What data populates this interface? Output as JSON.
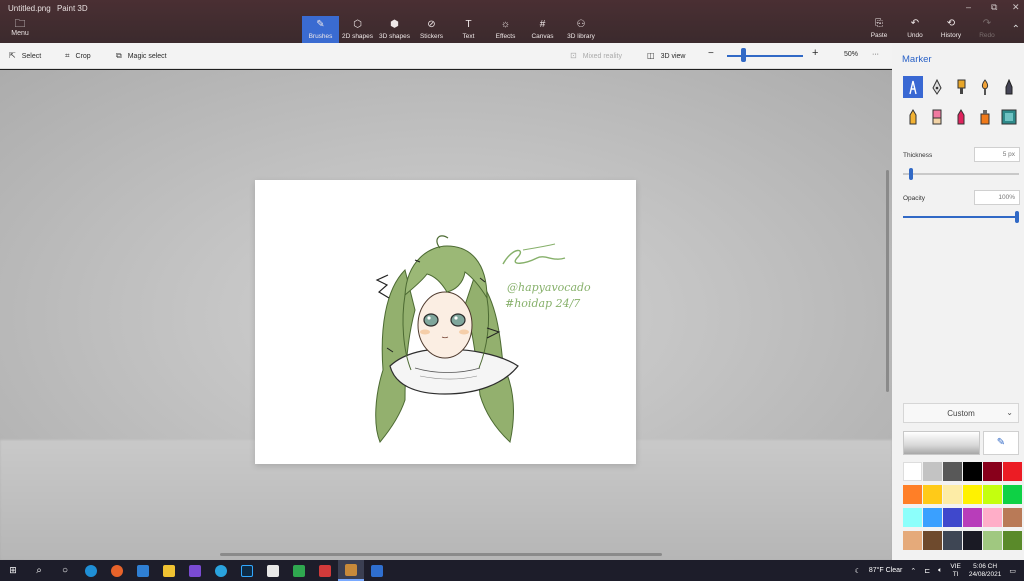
{
  "window": {
    "title": "Untitled.png",
    "app": "Paint 3D"
  },
  "ribbon": {
    "menu": "Menu",
    "tabs": [
      {
        "label": "Brushes",
        "icon": "brush-icon",
        "active": true
      },
      {
        "label": "2D shapes",
        "icon": "2d-shapes-icon"
      },
      {
        "label": "3D shapes",
        "icon": "3d-shapes-icon"
      },
      {
        "label": "Stickers",
        "icon": "stickers-icon"
      },
      {
        "label": "Text",
        "icon": "text-icon"
      },
      {
        "label": "Effects",
        "icon": "effects-icon"
      },
      {
        "label": "Canvas",
        "icon": "canvas-icon"
      },
      {
        "label": "3D library",
        "icon": "3d-library-icon"
      }
    ],
    "paste": "Paste",
    "undo": "Undo",
    "history": "History",
    "redo": "Redo"
  },
  "toolstrip": {
    "select": "Select",
    "crop": "Crop",
    "magic_select": "Magic select",
    "mixed_reality": "Mixed reality",
    "view_3d": "3D view",
    "zoom": "50%",
    "zoom_level": 0.2,
    "more": "···"
  },
  "panel": {
    "title": "Marker",
    "thickness_label": "Thickness",
    "thickness_value": "5 px",
    "thickness_level": 0.05,
    "opacity_label": "Opacity",
    "opacity_value": "100%",
    "opacity_level": 1.0,
    "color_mode": "Custom",
    "current_color": "#ffffff",
    "swatches": [
      "#ffffff",
      "#c3c3c3",
      "#585858",
      "#000000",
      "#88001b",
      "#ec1c24",
      "#ff7f27",
      "#ffca18",
      "#fdeca6",
      "#fff200",
      "#c4ff0e",
      "#0ed145",
      "#8cfffb",
      "#3aa0ff",
      "#3f48cc",
      "#b83dba",
      "#ffaec8",
      "#b97a57",
      "#e5aa7a",
      "#6e4a2d",
      "#3e4654",
      "#1a1a24",
      "#a0c880",
      "#5a8a2a"
    ]
  },
  "artwork": {
    "signature_text": "@hapyavocado",
    "tag_text": "#hoidap 24/7"
  },
  "taskbar": {
    "weather": "87°F Clear",
    "lang_top": "VIE",
    "lang_bottom": "TI",
    "time": "5:06 CH",
    "date": "24/08/2021"
  }
}
